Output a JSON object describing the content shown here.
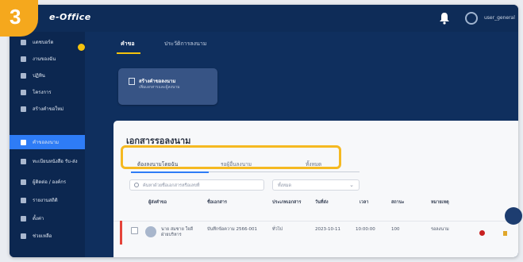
{
  "step_number": "3",
  "header": {
    "logo": "e-Office",
    "user": "user_general"
  },
  "sidebar": {
    "items": [
      {
        "label": "แดชบอร์ด",
        "active": false
      },
      {
        "label": "งานของฉัน",
        "active": false
      },
      {
        "label": "ปฏิทิน",
        "active": false
      },
      {
        "label": "โครงการ",
        "active": false
      },
      {
        "label": "สร้างคำขอใหม่",
        "active": false
      },
      {
        "label": "คำขอลงนาม",
        "active": true
      },
      {
        "label": "ทะเบียนหนังสือ รับ-ส่ง",
        "active": false
      },
      {
        "label": "ผู้ติดต่อ / องค์กร",
        "active": false
      },
      {
        "label": "รายงานสถิติ",
        "active": false
      },
      {
        "label": "ตั้งค่า",
        "active": false
      },
      {
        "label": "ช่วยเหลือ",
        "active": false
      }
    ]
  },
  "top_tabs": [
    "คำขอ",
    "ประวัติการลงนาม"
  ],
  "card": {
    "title": "สร้างคำขอลงนาม",
    "subtitle": "เพิ่มเอกสารและผู้ลงนาม"
  },
  "panel": {
    "title": "เอกสารรอลงนาม",
    "tabs": [
      "ต้องลงนามโดยฉัน",
      "รอผู้อื่นลงนาม",
      "ทั้งหมด"
    ],
    "search_placeholder": "ค้นหาด้วยชื่อเอกสารหรือเลขที่",
    "select_value": "ทั้งหมด",
    "columns": [
      "ผู้ส่งคำขอ",
      "ชื่อเอกสาร",
      "ประเภทเอกสาร",
      "วันที่ส่ง",
      "เวลา",
      "สถานะ",
      "หมายเหตุ"
    ],
    "rows": [
      {
        "sender": "นาย สมชาย ใจดี ฝ่ายบริหาร",
        "document": "บันทึกข้อความ 2566-001",
        "type": "ทั่วไป",
        "date": "2023-10-11",
        "time": "10:00:00",
        "num": "100",
        "status": "รอลงนาม"
      }
    ]
  },
  "colors": {
    "accent": "#2e7cf6",
    "highlight": "#f5b921",
    "sidebar": "#0c2750",
    "flag": "#e5433a"
  }
}
